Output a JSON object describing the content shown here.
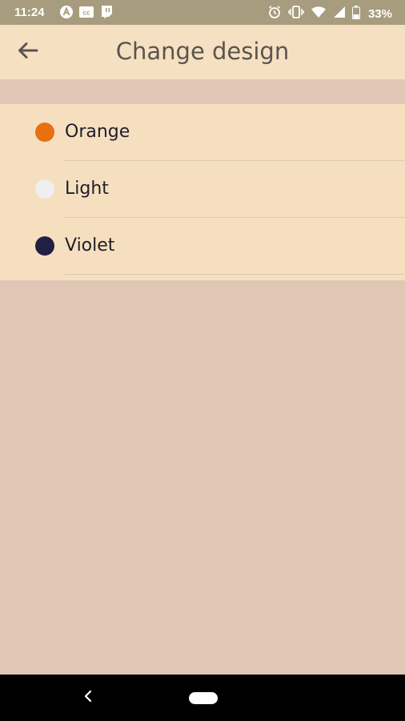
{
  "status_bar": {
    "time": "11:24",
    "left_icons": [
      "a-circle-icon",
      "cc-icon",
      "twitch-icon"
    ],
    "right_icons": [
      "alarm-icon",
      "vibrate-icon",
      "wifi-icon",
      "signal-icon",
      "battery-icon"
    ],
    "battery": "33%"
  },
  "app_bar": {
    "title": "Change design",
    "back_icon": "arrow-left-icon"
  },
  "designs": [
    {
      "label": "Orange",
      "color": "#e8700f"
    },
    {
      "label": "Light",
      "color": "#efefef"
    },
    {
      "label": "Violet",
      "color": "#212044"
    }
  ],
  "colors": {
    "page_background": "#e0c6b4",
    "list_background": "#f5dfbf",
    "app_bar_background": "#f5e1c2",
    "status_bar_background": "#a89c7e"
  },
  "nav_bar": {
    "back_icon": "chevron-left-icon",
    "home_icon": "home-pill-icon"
  }
}
